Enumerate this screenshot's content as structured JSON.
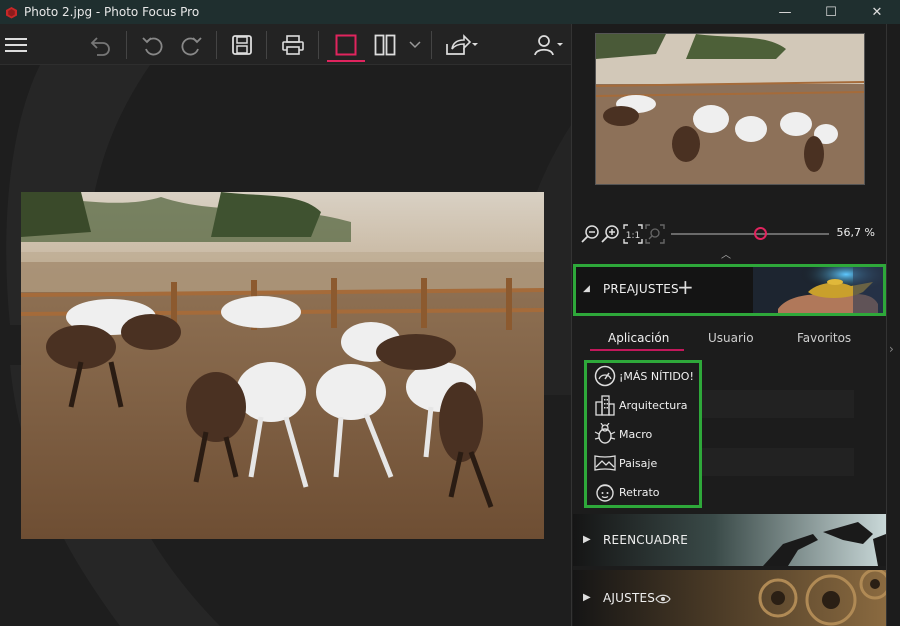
{
  "window": {
    "title": "Photo 2.jpg - Photo Focus Pro",
    "minimize": "—",
    "maximize": "☐",
    "close": "✕"
  },
  "toolbar": {
    "icons": [
      "menu-icon",
      "undo-all-icon",
      "undo-icon",
      "redo-icon",
      "save-icon",
      "print-icon",
      "single-view-icon",
      "split-view-icon",
      "chevron-down-icon",
      "share-icon",
      "user-icon"
    ]
  },
  "zoom": {
    "value": "56,7 %",
    "level": 0.567
  },
  "presets": {
    "title": "PREAJUSTES",
    "add_label": "+",
    "tabs": [
      {
        "label": "Aplicación",
        "active": true
      },
      {
        "label": "Usuario",
        "active": false
      },
      {
        "label": "Favoritos",
        "active": false
      }
    ],
    "items": [
      {
        "label": "¡MÁS NÍTIDO!",
        "icon": "gauge-icon"
      },
      {
        "label": "Arquitectura",
        "icon": "buildings-icon"
      },
      {
        "label": "Macro",
        "icon": "bug-icon"
      },
      {
        "label": "Paisaje",
        "icon": "landscape-icon"
      },
      {
        "label": "Retrato",
        "icon": "face-icon"
      }
    ]
  },
  "sections": {
    "reencuadre": "REENCUADRE",
    "ajustes": "AJUSTES"
  },
  "colors": {
    "accent": "#e0245e",
    "highlight_box": "#2ea83a",
    "titlebar": "#1f2f2f"
  }
}
